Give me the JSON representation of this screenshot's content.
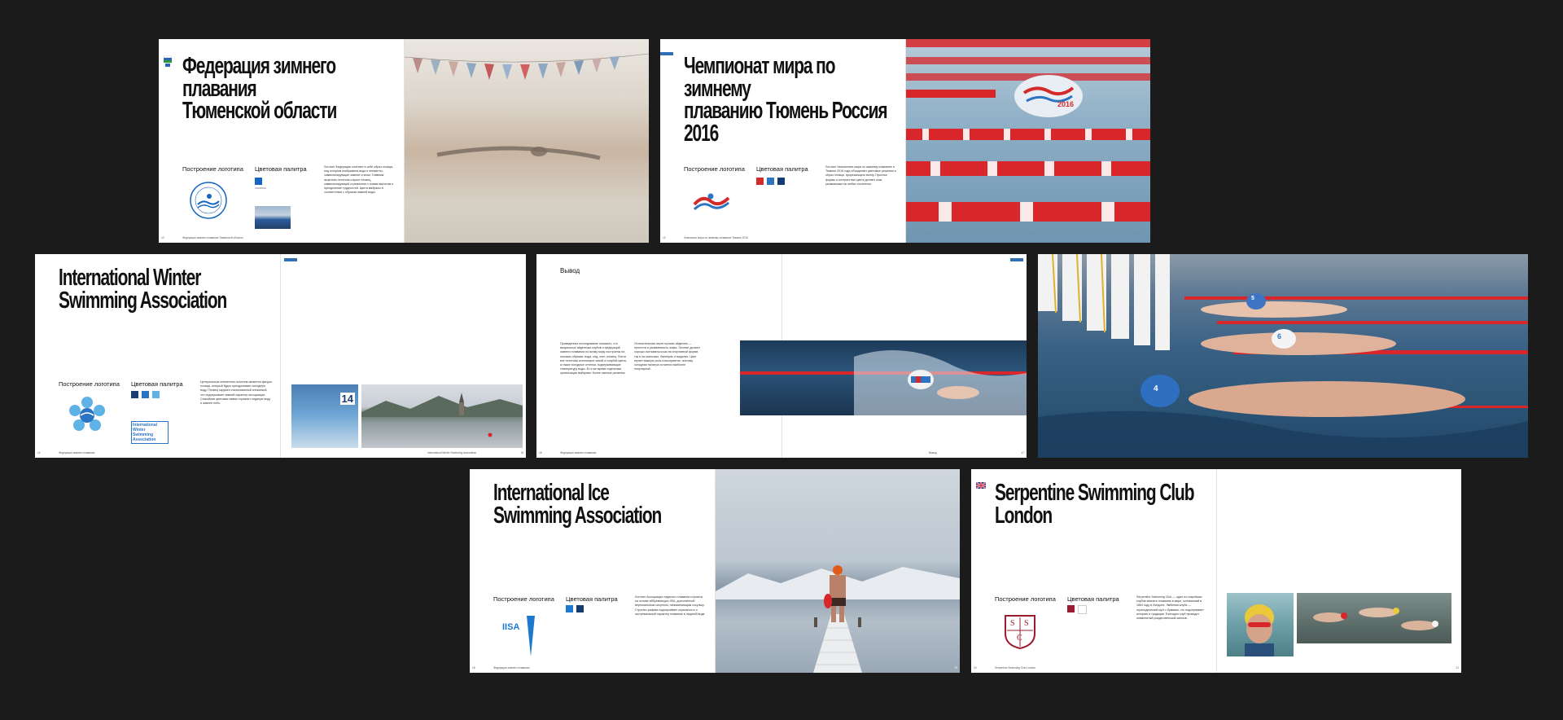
{
  "spreads": {
    "s1": {
      "title": "Федерация зимнего плавания\nТюменской области",
      "logo_label": "Построение логотипа",
      "palette_label": "Цветовая палитра",
      "swatches": [
        "#1566c0"
      ],
      "body": "Логотип Федерации сочетает в себе образ пловца, под которым изображена вода и элементы, символизирующие зимние стихии. Главным акцентом логотипа служит пловец, символизирующий стремление к новым высотам и преодоление трудностей. Цвета выбраны в соответствии с образом зимней воды.",
      "footer": "Федерация зимнего плавания Тюменской области",
      "folio": "10"
    },
    "s2": {
      "title": "Чемпионат мира по зимнему\nплаванию Тюмень Россия\n2016",
      "logo_label": "Построение логотипа",
      "palette_label": "Цветовая палитра",
      "swatches": [
        "#d42a2a",
        "#2d74c4",
        "#143a74"
      ],
      "body": "Логотип Чемпионата мира по зимнему плаванию в Тюмени 2016 года объединяет цветовые решения и образ пловца, прорезающего волну. Простые формы и контрастные цвета делают знак узнаваемым на любых носителях.",
      "footer": "Чемпионат мира по зимнему плаванию Тюмень 2016",
      "folio": "12",
      "badge": "2016"
    },
    "s3": {
      "title": "International Winter\nSwimming Association",
      "logo_label": "Построение логотипа",
      "palette_label": "Цветовая палитра",
      "swatches": [
        "#1a3d74",
        "#2b74c4",
        "#5fb2e6"
      ],
      "body": "Центральным элементом логотипа является фигура пловца, который будто преодолевает холодную воду. Пловец окружен стилизованной снежинкой, что подчеркивает зимний характер ассоциации. Спокойная цветовая гамма отражает ледяную воду и зимнее небо.",
      "wordmark": [
        "International",
        "Winter",
        "Swimming",
        "Association"
      ],
      "footer": "Федерация зимнего плавания",
      "footer_right": "International Winter Swimming Association",
      "folio_left": "14",
      "folio_right": "15",
      "lane_number": "14"
    },
    "s4": {
      "heading": "Вывод",
      "col1": "Проведенное исследование показало, что визуальные айдентики клубов и федераций зимнего плавания по всему миру построены на похожих образах: вода, лед, снег, пловец. Почти все логотипы используют синий и голубой цвета, а также холодные оттенки, подчеркивающие температуру воды. В то же время отдельные организации выбирают более смелые решения.",
      "col2": "Отличительная черта лучших айдентик — простота и узнаваемость знака. Логотип должен хорошо считываться как на спортивной форме, так и на шапочках, баннерах и медалях. Цвет играет важную роль в восприятии, поэтому холодная палитра остается наиболее популярной.",
      "footer": "Федерация зимнего плавания",
      "footer_right": "Вывод",
      "folio_left": "16",
      "folio_right": "17"
    },
    "s5": {
      "cap_numbers": [
        "6",
        "5",
        "4"
      ]
    },
    "s6": {
      "title": "International Ice\nSwimming Association",
      "logo_label": "Построение логотипа",
      "palette_label": "Цветовая палитра",
      "swatches": [
        "#1f78cf",
        "#153c6e"
      ],
      "body": "Логотип Ассоциации ледяного плавания строится на основе аббревиатуры IISA, дополненной вертикальным силуэтом, напоминающим сосульку. Строгая графика подчеркивает серьезность и экстремальный характер плавания в ледяной воде.",
      "wordmark": "IISA",
      "footer": "Федерация зимнего плавания",
      "folio_left": "18",
      "folio_right": "19"
    },
    "s7": {
      "title": "Serpentine Swimming Club\nLondon",
      "logo_label": "Построение логотипа",
      "palette_label": "Цветовая палитра",
      "swatches": [
        "#9b1c2e",
        "#ffffff"
      ],
      "body": "Serpentine Swimming Club — один из старейших клубов зимнего плавания в мире, основанный в 1864 году в Лондоне. Эмблема клуба — геральдический щит с буквами, что подчеркивает историю и традиции. Ежегодно клуб проводит знаменитый рождественский заплыв.",
      "crest": [
        "S",
        "S",
        "C"
      ],
      "footer": "Serpentine Swimming Club London",
      "folio_left": "20",
      "folio_right": "21"
    }
  },
  "colors": {
    "background": "#1b1b1b",
    "accent_blue": "#1566c0",
    "lane_red": "#d8262b"
  }
}
